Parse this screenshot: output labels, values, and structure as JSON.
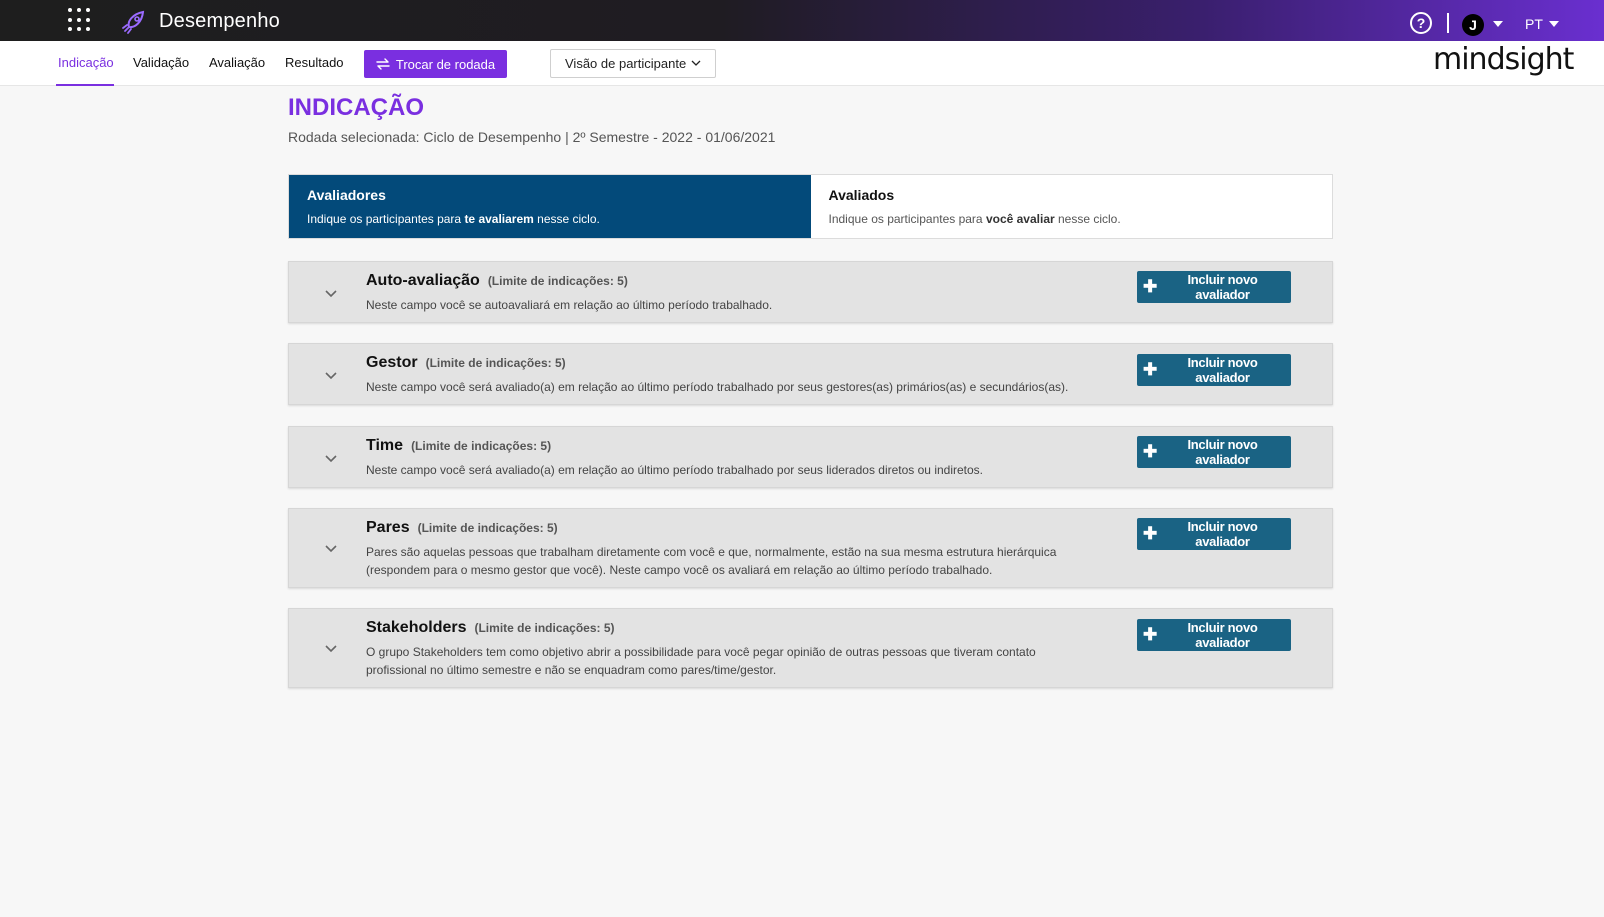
{
  "app": {
    "title": "Desempenho",
    "brand": "mindsight",
    "avatar_initial": "J",
    "language": "PT",
    "help_glyph": "?"
  },
  "nav": {
    "tabs": [
      {
        "label": "Indicação",
        "active": true
      },
      {
        "label": "Validação"
      },
      {
        "label": "Avaliação"
      },
      {
        "label": "Resultado"
      }
    ],
    "swap_button": "Trocar de rodada",
    "view_select": "Visão de participante"
  },
  "page": {
    "title": "INDICAÇÃO",
    "round_info": "Rodada selecionada: Ciclo de Desempenho | 2º Semestre - 2022 - 01/06/2021"
  },
  "toggle": {
    "evaluators": {
      "title": "Avaliadores",
      "desc_pre": "Indique os participantes para ",
      "desc_bold": "te avaliarem",
      "desc_post": " nesse ciclo."
    },
    "evaluated": {
      "title": "Avaliados",
      "desc_pre": "Indique os participantes para ",
      "desc_bold": "você avaliar",
      "desc_post": " nesse ciclo."
    }
  },
  "sections": [
    {
      "title": "Auto-avaliação",
      "limit": "(Limite de indicações: 5)",
      "desc": "Neste campo você se autoavaliará em relação ao último período trabalhado.",
      "button": "Incluir novo avaliador"
    },
    {
      "title": "Gestor",
      "limit": "(Limite de indicações: 5)",
      "desc": "Neste campo você será avaliado(a) em relação ao último período trabalhado por seus gestores(as) primários(as) e secundários(as).",
      "button": "Incluir novo avaliador"
    },
    {
      "title": "Time",
      "limit": "(Limite de indicações: 5)",
      "desc": "Neste campo você será avaliado(a) em relação ao último período trabalhado por seus liderados diretos ou indiretos.",
      "button": "Incluir novo avaliador"
    },
    {
      "title": "Pares",
      "limit": "(Limite de indicações: 5)",
      "desc": "Pares são aquelas pessoas que trabalham diretamente com você e que, normalmente, estão na sua mesma estrutura hierárquica (respondem para o mesmo gestor que você). Neste campo você os avaliará em relação ao último período trabalhado.",
      "button": "Incluir novo avaliador"
    },
    {
      "title": "Stakeholders",
      "limit": "(Limite de indicações: 5)",
      "desc": "O grupo Stakeholders tem como objetivo abrir a possibilidade para você pegar opinião de outras pessoas que tiveram contato profissional no último semestre e não se enquadram como pares/time/gestor.",
      "button": "Incluir novo avaliador"
    }
  ],
  "colors": {
    "accent": "#7a2fe0",
    "active_tab_bg": "#034a7a",
    "button_bg": "#1a6384"
  }
}
